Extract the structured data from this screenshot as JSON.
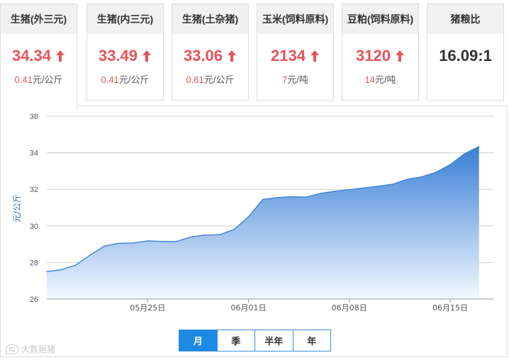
{
  "cards": [
    {
      "title": "生猪(外三元)",
      "price": "34.34",
      "trend": "up",
      "change": "0.41",
      "unit": "元/公斤"
    },
    {
      "title": "生猪(内三元)",
      "price": "33.49",
      "trend": "up",
      "change": "0.41",
      "unit": "元/公斤"
    },
    {
      "title": "生猪(土杂猪)",
      "price": "33.06",
      "trend": "up",
      "change": "0.61",
      "unit": "元/公斤"
    },
    {
      "title": "玉米(饲料原料)",
      "price": "2134",
      "trend": "up",
      "change": "7",
      "unit": "元/吨"
    },
    {
      "title": "豆粕(饲料原料)",
      "price": "3120",
      "trend": "up",
      "change": "14",
      "unit": "元/吨"
    },
    {
      "title": "猪粮比",
      "price": "16.09:1",
      "trend": "none",
      "change": "",
      "unit": ""
    }
  ],
  "colors": {
    "up": "#e5545b",
    "line": "#3f82d4",
    "area_top": "#3a7fd6",
    "area_bottom": "#f3f8fe",
    "tab_active": "#1e88e5"
  },
  "chart_data": {
    "type": "area",
    "ylabel": "元/公斤",
    "ylim": [
      26,
      36
    ],
    "yticks": [
      26,
      28,
      30,
      32,
      34,
      36
    ],
    "xticks": [
      {
        "day": 7,
        "label": "05月25日"
      },
      {
        "day": 14,
        "label": "06月01日"
      },
      {
        "day": 21,
        "label": "06月08日"
      },
      {
        "day": 28,
        "label": "06月15日"
      }
    ],
    "x_range": [
      0,
      31
    ],
    "grid": true,
    "series": [
      {
        "values": [
          27.5,
          27.6,
          27.85,
          28.4,
          28.9,
          29.05,
          29.07,
          29.18,
          29.15,
          29.15,
          29.4,
          29.5,
          29.52,
          29.8,
          30.5,
          31.45,
          31.55,
          31.6,
          31.58,
          31.78,
          31.9,
          31.98,
          32.08,
          32.17,
          32.28,
          32.55,
          32.68,
          32.93,
          33.35,
          33.95,
          34.34
        ]
      }
    ]
  },
  "range_tabs": [
    {
      "label": "月",
      "active": true
    },
    {
      "label": "季",
      "active": false
    },
    {
      "label": "半年",
      "active": false
    },
    {
      "label": "年",
      "active": false
    }
  ],
  "watermark": {
    "badge": "IC",
    "text": "大数据猪"
  }
}
